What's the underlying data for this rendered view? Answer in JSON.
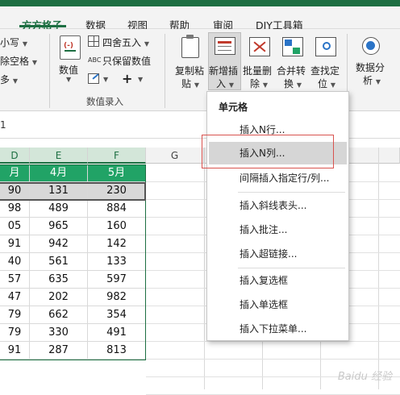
{
  "ribbon_tabs": [
    "方方格子",
    "数据",
    "视图",
    "帮助",
    "审阅",
    "DIY工具箱"
  ],
  "active_tab": "方方格子",
  "left_partial": {
    "row1": "小写",
    "row2": "除空格",
    "row3": "多"
  },
  "numeric_group": {
    "big_button": "数值",
    "round_label": "四舍五入",
    "keep_values_label": "只保留数值",
    "plus_glyph": "+",
    "group_label": "数值录入"
  },
  "ribbon_buttons": [
    {
      "line1": "复制粘",
      "line2": "贴"
    },
    {
      "line1": "新增插",
      "line2": "入"
    },
    {
      "line1": "批量删",
      "line2": "除"
    },
    {
      "line1": "合并转",
      "line2": "换"
    },
    {
      "line1": "查找定",
      "line2": "位"
    },
    {
      "line1": "数据分",
      "line2": "析"
    }
  ],
  "name_box_fragment": "1",
  "columns": [
    "D",
    "E",
    "F",
    "G"
  ],
  "table": {
    "headers": [
      "月",
      "4月",
      "5月"
    ],
    "rows": [
      [
        "90",
        "131",
        "230"
      ],
      [
        "98",
        "489",
        "884"
      ],
      [
        "05",
        "965",
        "160"
      ],
      [
        "91",
        "942",
        "142"
      ],
      [
        "40",
        "561",
        "133"
      ],
      [
        "57",
        "635",
        "597"
      ],
      [
        "47",
        "202",
        "982"
      ],
      [
        "79",
        "662",
        "354"
      ],
      [
        "79",
        "330",
        "491"
      ],
      [
        "91",
        "287",
        "813"
      ]
    ]
  },
  "menu": {
    "title": "单元格",
    "items": [
      "插入N行...",
      "插入N列...",
      "间隔插入指定行/列...",
      "插入斜线表头...",
      "插入批注...",
      "插入超链接...",
      "插入复选框",
      "插入单选框",
      "插入下拉菜单..."
    ],
    "highlighted_index": 1
  },
  "watermark": "Baidu 经验",
  "colors": {
    "accent": "#1d6f42",
    "header_fill": "#21a366",
    "selection": "#d8d8d8",
    "annotation": "#d9534f"
  }
}
